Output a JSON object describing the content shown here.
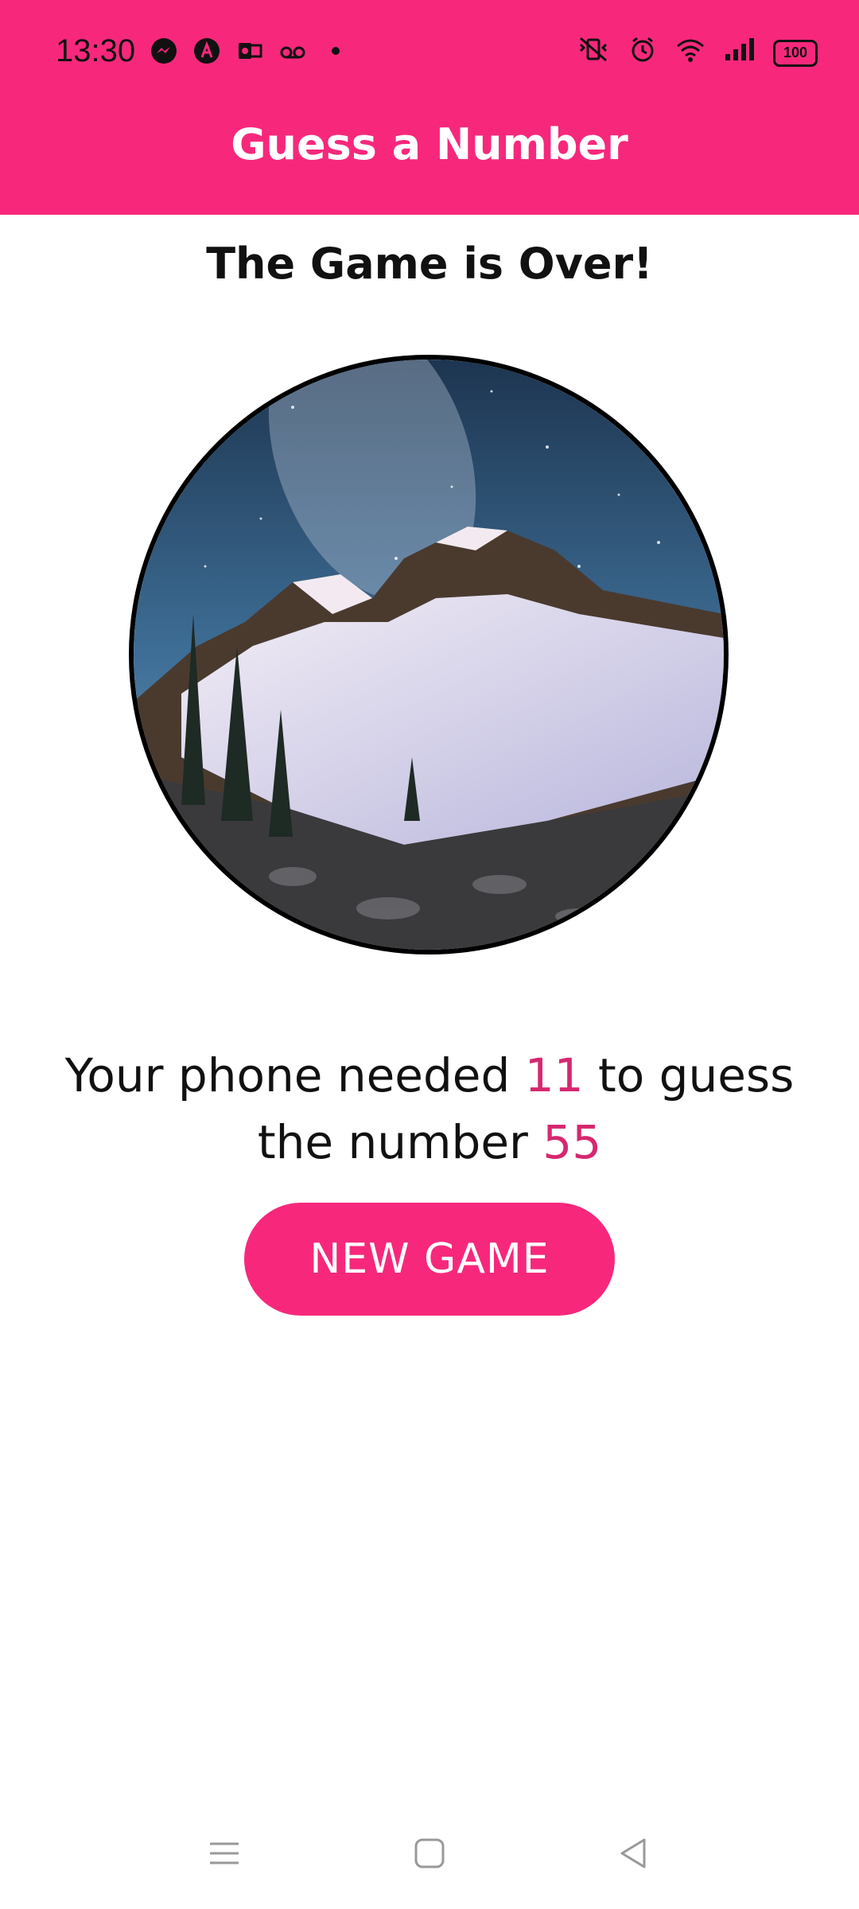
{
  "status_bar": {
    "time": "13:30",
    "battery": "100",
    "left_icons": [
      "messenger-icon",
      "app-a-icon",
      "outlook-icon",
      "voicemail-icon",
      "dot-icon"
    ],
    "right_icons": [
      "vibrate-icon",
      "alarm-icon",
      "wifi-icon",
      "signal-icon",
      "battery-icon"
    ]
  },
  "header": {
    "title": "Guess a Number"
  },
  "main": {
    "heading": "The Game is Over!",
    "result_prefix": "Your phone needed ",
    "rounds": "11",
    "result_middle": " to guess the number ",
    "user_number": "55",
    "new_game_label": "NEW GAME"
  },
  "colors": {
    "accent": "#F7287B",
    "highlight": "#D6286F"
  },
  "nav_bar": {
    "icons": [
      "menu-icon",
      "home-icon",
      "back-icon"
    ]
  }
}
